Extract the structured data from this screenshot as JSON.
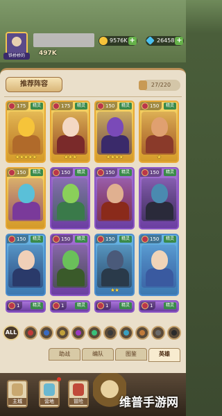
{
  "header": {
    "avatar_tag": "铁桥桥的",
    "power": "497K",
    "gold": "9576K",
    "gems": "26458",
    "plus": "+"
  },
  "toolbar": {
    "recommend_label": "推荐阵容",
    "capacity": "27/220"
  },
  "cards": [
    {
      "lvl": "175",
      "badge": "精灵",
      "stars": "★★★★★",
      "rarity": "gold",
      "skin": "#f6c43a",
      "body": "#b06a2a"
    },
    {
      "lvl": "175",
      "badge": "精灵",
      "stars": "★★★",
      "rarity": "gold",
      "skin": "#f4d8c4",
      "body": "#7a2a2a"
    },
    {
      "lvl": "150",
      "badge": "精灵",
      "stars": "★★★★",
      "rarity": "gold",
      "skin": "#7a4ab8",
      "body": "#3a2a6a"
    },
    {
      "lvl": "150",
      "badge": "精灵",
      "stars": "★",
      "rarity": "gold",
      "skin": "#e0a070",
      "body": "#8a3a2a"
    },
    {
      "lvl": "150",
      "badge": "精灵",
      "stars": "",
      "rarity": "gold",
      "skin": "#5ac0d8",
      "body": "#7a3a9a"
    },
    {
      "lvl": "150",
      "badge": "精灵",
      "stars": "",
      "rarity": "purple",
      "skin": "#8ad05a",
      "body": "#3a7a4a"
    },
    {
      "lvl": "150",
      "badge": "精灵",
      "stars": "",
      "rarity": "purple",
      "skin": "#e0b090",
      "body": "#8a2a1a"
    },
    {
      "lvl": "150",
      "badge": "精灵",
      "stars": "",
      "rarity": "purple",
      "skin": "#4a8ab0",
      "body": "#2a2a3a"
    },
    {
      "lvl": "150",
      "badge": "精灵",
      "stars": "",
      "rarity": "blue",
      "skin": "#f0d0b8",
      "body": "#2a3a6a"
    },
    {
      "lvl": "150",
      "badge": "精灵",
      "stars": "",
      "rarity": "purple",
      "skin": "#6ac05a",
      "body": "#3a5a2a"
    },
    {
      "lvl": "150",
      "badge": "精灵",
      "stars": "★★",
      "rarity": "blue",
      "skin": "#4a5a7a",
      "body": "#2a3a4a"
    },
    {
      "lvl": "150",
      "badge": "精灵",
      "stars": "",
      "rarity": "blue",
      "skin": "#f0d4b8",
      "body": "#3a5aa0"
    },
    {
      "lvl": "1",
      "badge": "精灵",
      "stars": "",
      "rarity": "purple",
      "skin": "#a070c8",
      "body": "#6a3fa0"
    },
    {
      "lvl": "1",
      "badge": "精灵",
      "stars": "",
      "rarity": "purple",
      "skin": "#a070c8",
      "body": "#6a3fa0"
    },
    {
      "lvl": "1",
      "badge": "精灵",
      "stars": "",
      "rarity": "purple",
      "skin": "#a070c8",
      "body": "#6a3fa0"
    },
    {
      "lvl": "1",
      "badge": "精灵",
      "stars": "",
      "rarity": "purple",
      "skin": "#a070c8",
      "body": "#6a3fa0"
    }
  ],
  "filters": {
    "all_label": "ALL",
    "icons": [
      "#c03a3a",
      "#3a6ac0",
      "#c0a03a",
      "#9a3ac0",
      "#3ac07a",
      "#3a3a3a",
      "#3aa0c0",
      "#c07a3a",
      "#6a6a6a",
      "#2a2a2a"
    ]
  },
  "tabs": [
    "助战",
    "编队",
    "图鉴",
    "英雄"
  ],
  "bottom_nav": [
    {
      "label": "主城",
      "color": "#c9a870"
    },
    {
      "label": "营地",
      "color": "#6ab8d0"
    },
    {
      "label": "冒险",
      "color": "#c04a3a"
    }
  ],
  "watermark": "维普手游网"
}
